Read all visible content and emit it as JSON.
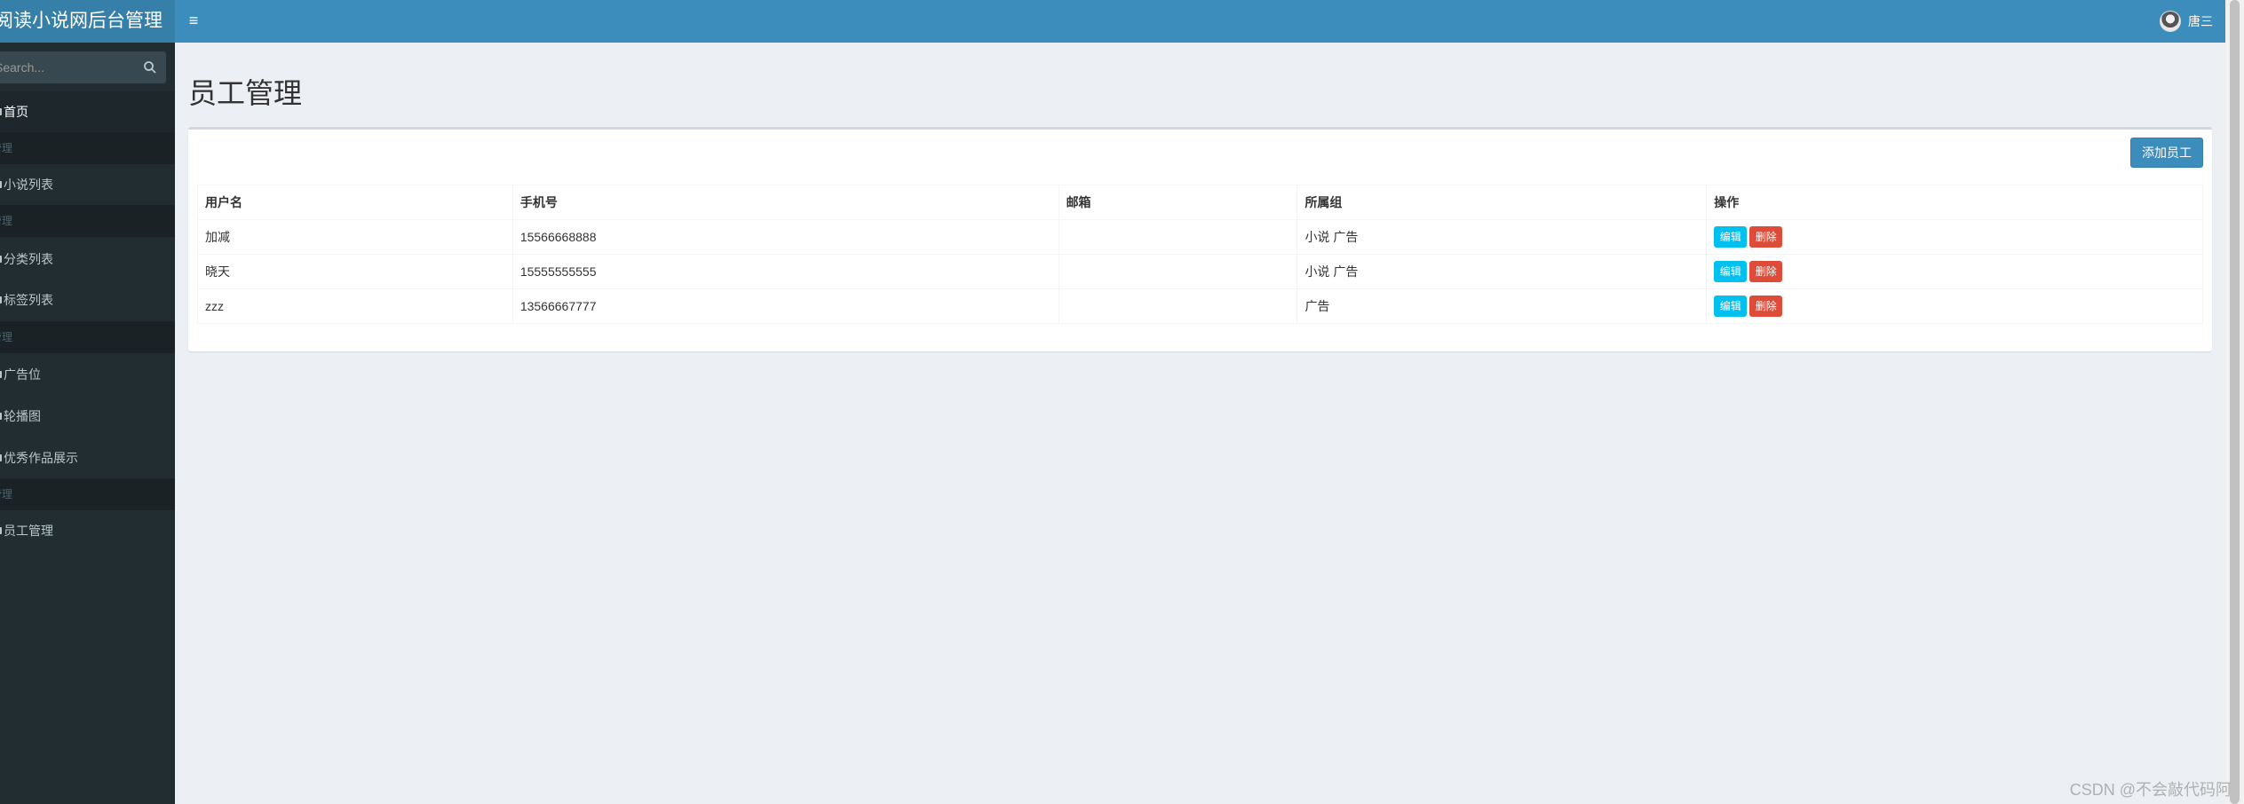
{
  "header": {
    "app_title": "阅读小说网后台管理",
    "menu_icon": "hamburger-icon",
    "user_name": "唐三"
  },
  "sidebar": {
    "search_placeholder": "Search...",
    "items": [
      {
        "type": "item",
        "label": "首页",
        "active": true
      },
      {
        "type": "header",
        "label": "管理"
      },
      {
        "type": "item",
        "label": "小说列表"
      },
      {
        "type": "header",
        "label": "管理"
      },
      {
        "type": "item",
        "label": "分类列表"
      },
      {
        "type": "item",
        "label": "标签列表"
      },
      {
        "type": "header",
        "label": "管理"
      },
      {
        "type": "item",
        "label": "广告位"
      },
      {
        "type": "item",
        "label": "轮播图"
      },
      {
        "type": "item",
        "label": "优秀作品展示"
      },
      {
        "type": "header",
        "label": "管理"
      },
      {
        "type": "item",
        "label": "员工管理"
      }
    ]
  },
  "main": {
    "page_title": "员工管理",
    "add_button": "添加员工",
    "table": {
      "columns": [
        "用户名",
        "手机号",
        "邮箱",
        "所属组",
        "操作"
      ],
      "rows": [
        {
          "username": "加减",
          "phone": "15566668888",
          "email": "",
          "group": "小说 广告"
        },
        {
          "username": "晓天",
          "phone": "15555555555",
          "email": "",
          "group": "小说 广告"
        },
        {
          "username": "zzz",
          "phone": "13566667777",
          "email": "",
          "group": "广告"
        }
      ],
      "edit_label": "编辑",
      "delete_label": "删除"
    }
  },
  "watermark": "CSDN @不会敲代码阿",
  "colors": {
    "header_bg": "#3c8dbc",
    "sidebar_bg": "#222d32",
    "edit_btn": "#00c0ef",
    "delete_btn": "#dd4b39"
  }
}
